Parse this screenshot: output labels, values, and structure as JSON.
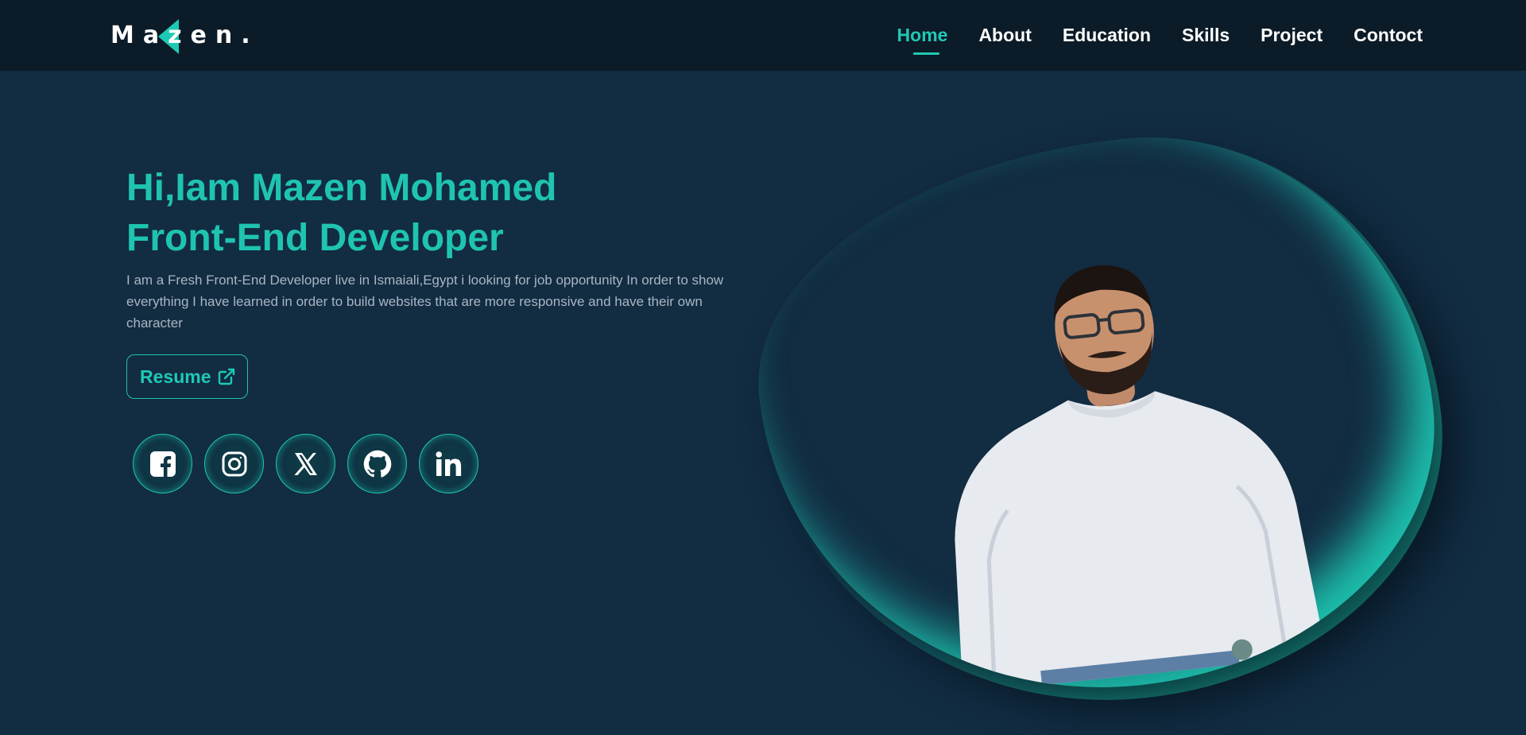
{
  "brand": {
    "logo_text": "Mazen."
  },
  "nav": {
    "items": [
      {
        "label": "Home",
        "active": true
      },
      {
        "label": "About"
      },
      {
        "label": "Education"
      },
      {
        "label": "Skills"
      },
      {
        "label": "Project"
      },
      {
        "label": "Contoct"
      }
    ]
  },
  "hero": {
    "title_line1": "Hi,Iam Mazen Mohamed",
    "title_line2": "Front-End Developer",
    "description": "I am a Fresh Front-End Developer live in Ismaiali,Egypt i looking for job opportunity In order to show everything I have learned in order to build websites that are more responsive and have their own character",
    "resume_label": "Resume"
  },
  "socials": [
    {
      "icon": "facebook-icon"
    },
    {
      "icon": "instagram-icon"
    },
    {
      "icon": "x-icon"
    },
    {
      "icon": "github-icon"
    },
    {
      "icon": "linkedin-icon"
    }
  ],
  "colors": {
    "accent": "#1fc9b5",
    "nav_bg": "#0b1b27",
    "page_bg": "#122c42",
    "text_muted": "#a9b6c3"
  }
}
